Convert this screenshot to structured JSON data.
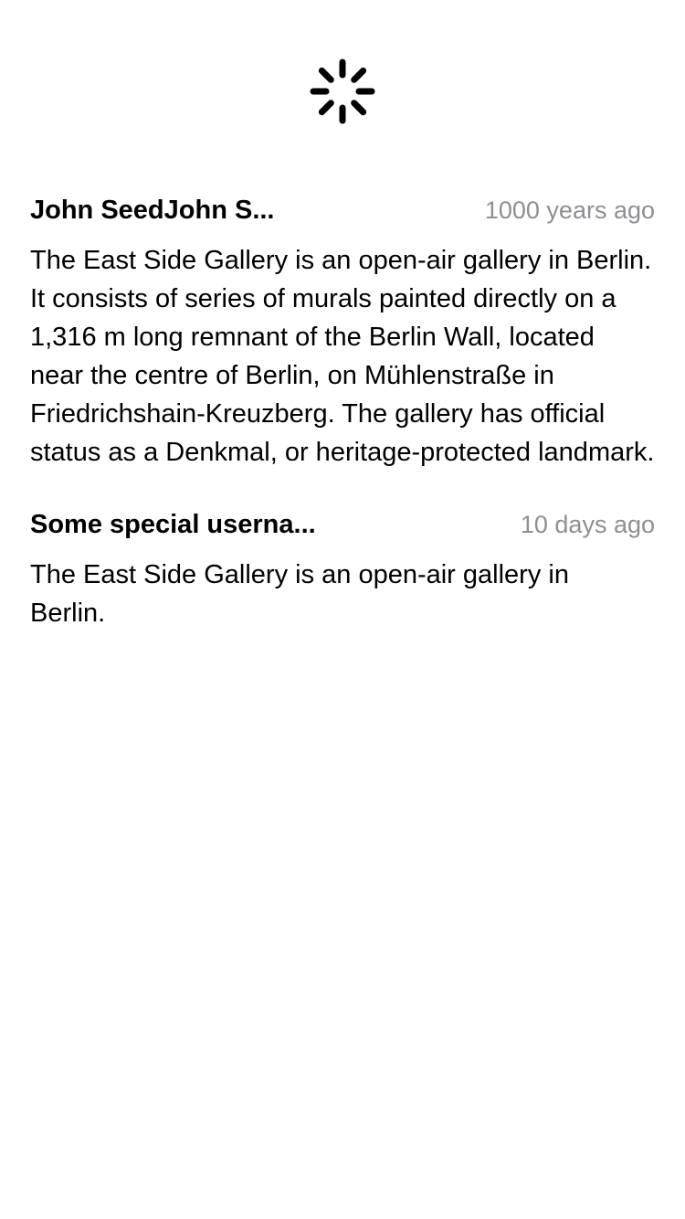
{
  "loader": {
    "icon": "activity-spinner-icon"
  },
  "comments": [
    {
      "author": "John SeedJohn S...",
      "timestamp": "1000 years ago",
      "body": "The East Side Gallery is an open-air gallery in Berlin. It consists of series of murals painted directly on a 1,316 m long remnant of the Berlin Wall, located near the centre of Berlin, on Mühlenstraße in Friedrichshain-Kreuzberg. The gallery has official status as a Denkmal, or heritage-protected landmark."
    },
    {
      "author": "Some special userna...",
      "timestamp": "10 days ago",
      "body": "The East Side Gallery is an open-air gallery in Berlin."
    }
  ],
  "colors": {
    "text": "#000000",
    "secondary_text": "#8e8e93",
    "background": "#ffffff"
  }
}
